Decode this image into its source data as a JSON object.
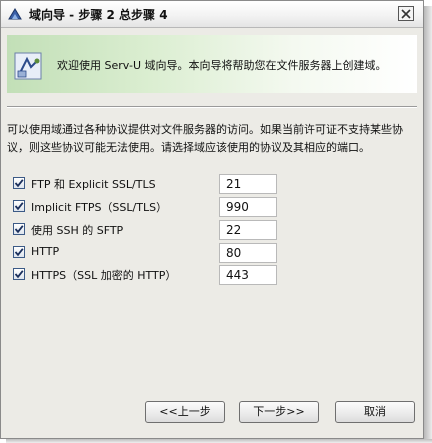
{
  "window": {
    "title": "域向导 - 步骤 2 总步骤 4",
    "close_icon": "close-icon"
  },
  "banner": {
    "text": "欢迎使用 Serv-U 域向导。本向导将帮助您在文件服务器上创建域。",
    "icon": "wizard-icon"
  },
  "description": {
    "line1": "可以使用域通过各种协议提供对文件服务器的访问。如果当前许可证不支持某些协",
    "line2": "议，则这些协议可能无法使用。请选择域应该使用的协议及其相应的端口。"
  },
  "protocols": [
    {
      "label": "FTP 和  Explicit SSL/TLS",
      "checked": true,
      "port": "21"
    },
    {
      "label": "Implicit FTPS（SSL/TLS）",
      "checked": true,
      "port": "990"
    },
    {
      "label": "使用  SSH 的  SFTP",
      "checked": true,
      "port": "22"
    },
    {
      "label": "HTTP",
      "checked": true,
      "port": "80"
    },
    {
      "label": "HTTPS（SSL 加密的  HTTP）",
      "checked": true,
      "port": "443"
    }
  ],
  "buttons": {
    "back": "<<上一步",
    "next": "下一步>>",
    "cancel": "取消"
  },
  "colors": {
    "banner_gradient_start": "#c2dfb7",
    "window_bg": "#ecebe6"
  }
}
